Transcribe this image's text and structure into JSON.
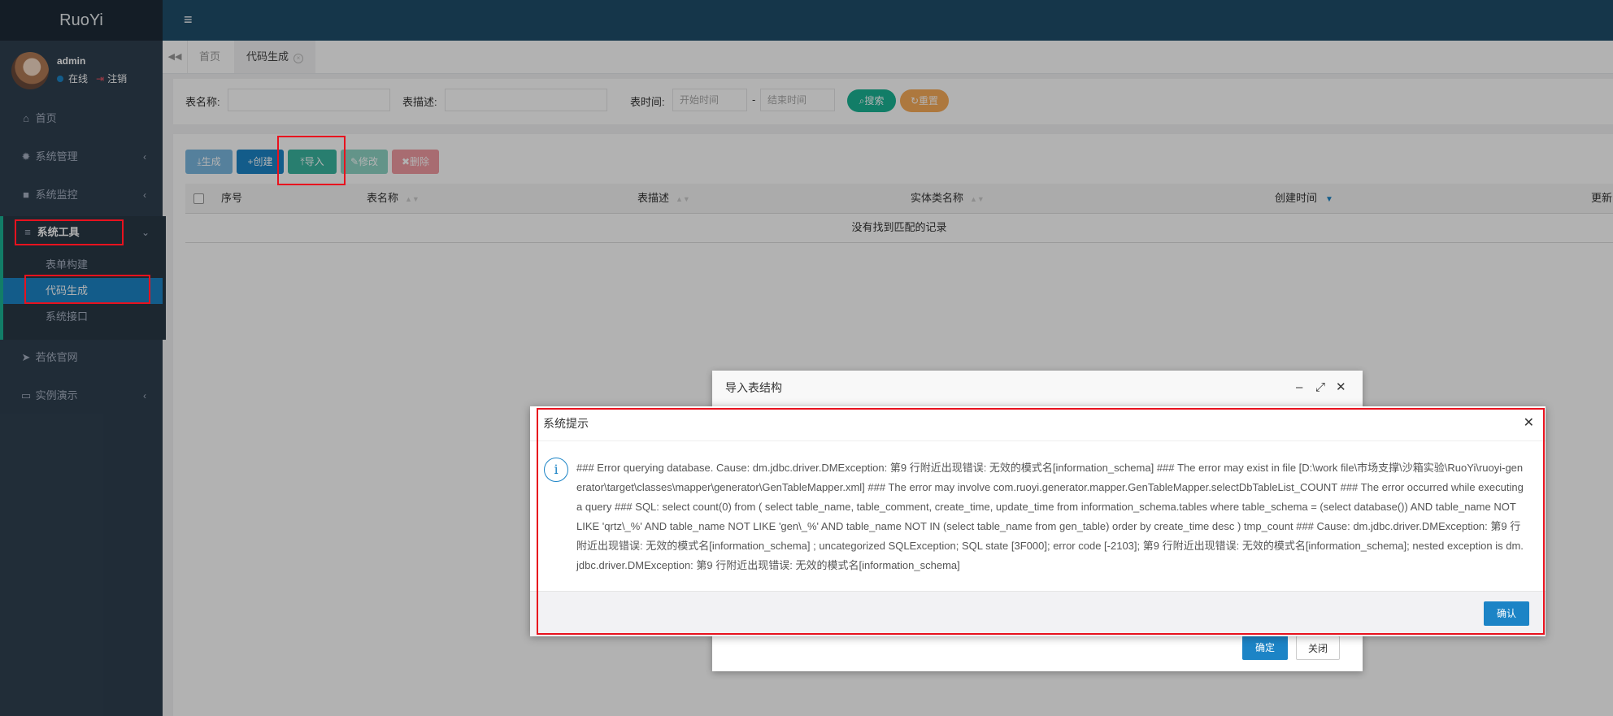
{
  "app": {
    "logo": "RuoYi"
  },
  "user": {
    "name": "admin",
    "status": "在线",
    "logout": "注销"
  },
  "sidebar": {
    "items": [
      {
        "label": "首页",
        "icon": "home-icon"
      },
      {
        "label": "系统管理",
        "icon": "gear-icon"
      },
      {
        "label": "系统监控",
        "icon": "video-icon"
      },
      {
        "label": "系统工具",
        "icon": "bars-icon"
      },
      {
        "label": "若依官网",
        "icon": "send-icon"
      },
      {
        "label": "实例演示",
        "icon": "desktop-icon"
      }
    ],
    "subitems": [
      {
        "label": "表单构建"
      },
      {
        "label": "代码生成"
      },
      {
        "label": "系统接口"
      }
    ]
  },
  "tabs": [
    {
      "label": "首页"
    },
    {
      "label": "代码生成"
    }
  ],
  "search": {
    "table_name_label": "表名称:",
    "table_desc_label": "表描述:",
    "table_time_label": "表时间:",
    "start_placeholder": "开始时间",
    "end_placeholder": "结束时间",
    "dash": "-",
    "search_btn": "搜索",
    "reset_btn": "重置"
  },
  "toolbar": {
    "generate": "生成",
    "create": "创建",
    "import": "导入",
    "edit": "修改",
    "delete": "删除"
  },
  "table": {
    "columns": [
      "序号",
      "表名称",
      "表描述",
      "实体类名称",
      "创建时间",
      "更新"
    ],
    "empty": "没有找到匹配的记录"
  },
  "import_dialog": {
    "title": "导入表结构",
    "confirm": "确定",
    "close": "关闭"
  },
  "alert": {
    "title": "系统提示",
    "message": "### Error querying database. Cause: dm.jdbc.driver.DMException: 第9 行附近出现错误: 无效的模式名[information_schema] ### The error may exist in file [D:\\work file\\市场支撑\\沙箱实验\\RuoYi\\ruoyi-generator\\target\\classes\\mapper\\generator\\GenTableMapper.xml] ### The error may involve com.ruoyi.generator.mapper.GenTableMapper.selectDbTableList_COUNT ### The error occurred while executing a query ### SQL: select count(0) from ( select table_name, table_comment, create_time, update_time from information_schema.tables where table_schema = (select database()) AND table_name NOT LIKE 'qrtz\\_%' AND table_name NOT LIKE 'gen\\_%' AND table_name NOT IN (select table_name from gen_table) order by create_time desc ) tmp_count ### Cause: dm.jdbc.driver.DMException: 第9 行附近出现错误: 无效的模式名[information_schema] ; uncategorized SQLException; SQL state [3F000]; error code [-2103]; 第9 行附近出现错误: 无效的模式名[information_schema]; nested exception is dm.jdbc.driver.DMException: 第9 行附近出现错误: 无效的模式名[information_schema]",
    "ok": "确认"
  },
  "colors": {
    "sidebar_bg": "#2f4050",
    "header_bg": "#1f4e6b",
    "primary": "#1c84c6",
    "success": "#1ab394",
    "warning": "#f8ac59",
    "danger": "#ed5565",
    "annotation_red": "#e8121e"
  }
}
